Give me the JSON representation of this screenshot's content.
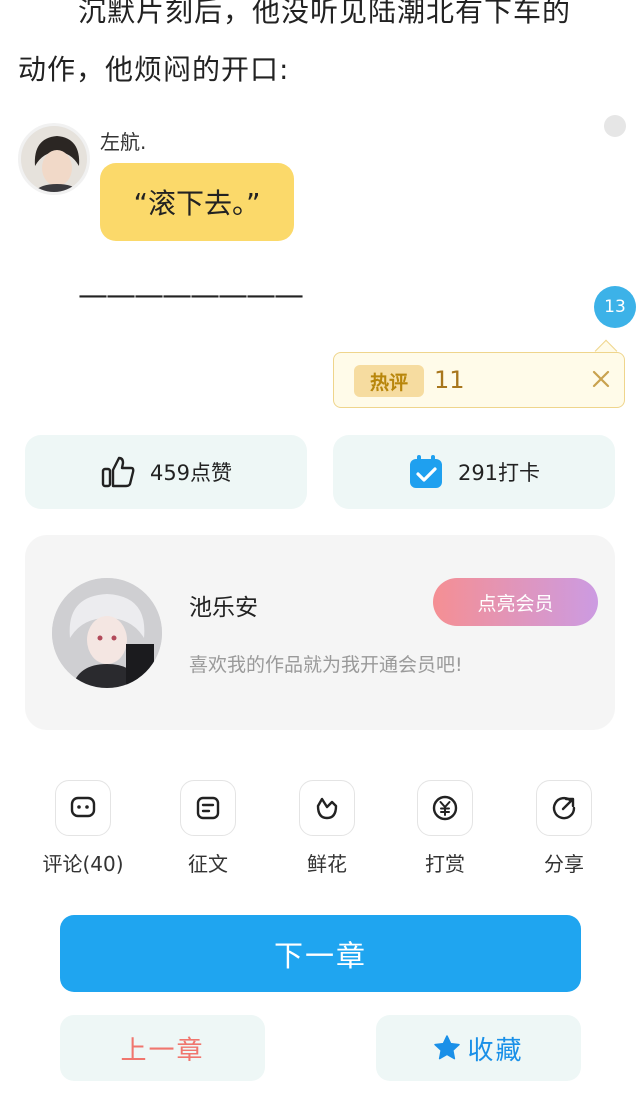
{
  "story": {
    "line1": "沉默片刻后，他没听见陆潮北有下车的",
    "line2": "动作，他烦闷的开口:",
    "dialog_speaker": "左航.",
    "dialog_text": "“滚下去。”",
    "separator": "————————"
  },
  "comment_badge": {
    "count": "13"
  },
  "hot_comment_popup": {
    "tag": "热评",
    "count": "11",
    "close_icon": "close-icon"
  },
  "stats": {
    "like_label": "459点赞",
    "like_icon": "thumbs-up-icon",
    "checkin_label": "291打卡",
    "checkin_icon": "calendar-check-icon"
  },
  "author_card": {
    "name": "池乐安",
    "message": "喜欢我的作品就为我开通会员吧!",
    "vip_button": "点亮会员"
  },
  "actions": [
    {
      "label": "评论(40)",
      "icon": "comment-icon"
    },
    {
      "label": "征文",
      "icon": "essay-icon"
    },
    {
      "label": "鲜花",
      "icon": "flower-icon"
    },
    {
      "label": "打赏",
      "icon": "yen-coin-icon"
    },
    {
      "label": "分享",
      "icon": "share-icon"
    }
  ],
  "navigation": {
    "next_chapter": "下一章",
    "prev_chapter": "上一章",
    "favorite": "收藏"
  },
  "colors": {
    "bubble": "#fbd96a",
    "primary_blue": "#1fa5f0",
    "badge_blue": "#3cb2e8",
    "prev_red": "#f0766e",
    "vip_gradient_start": "#f58f93",
    "vip_gradient_end": "#cc9be2"
  }
}
